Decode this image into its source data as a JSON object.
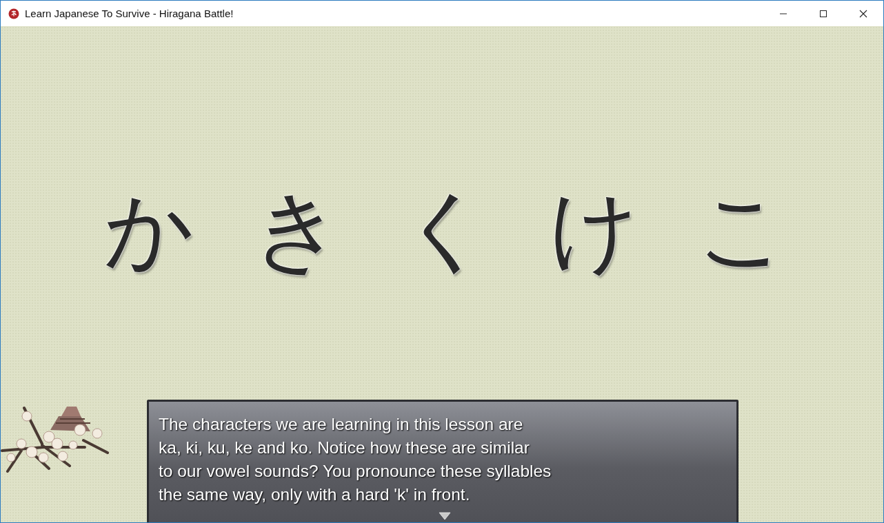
{
  "window": {
    "title": "Learn Japanese To Survive - Hiragana Battle!"
  },
  "characters": [
    "か",
    "き",
    "く",
    "け",
    "こ"
  ],
  "dialog": {
    "text": "The characters we are learning in this lesson are\nka, ki, ku, ke and ko. Notice how these are similar\nto our vowel sounds? You pronounce these syllables\nthe same way, only with a hard 'k' in front."
  }
}
